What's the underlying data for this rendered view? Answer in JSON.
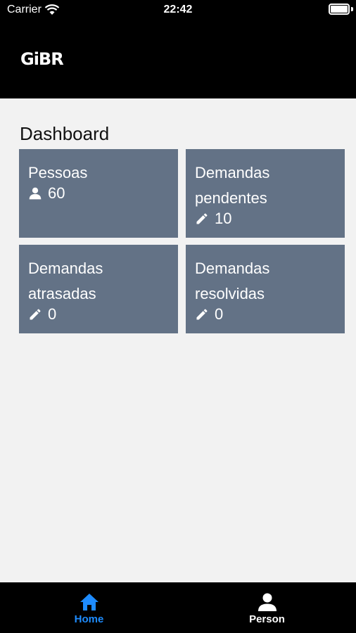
{
  "status_bar": {
    "carrier": "Carrier",
    "time": "22:42"
  },
  "header": {
    "logo": "GiBR"
  },
  "page": {
    "title": "Dashboard"
  },
  "cards": [
    {
      "title": "Pessoas",
      "value": "60",
      "icon": "person-icon"
    },
    {
      "title": "Demandas pendentes",
      "value": "10",
      "icon": "pencil-icon"
    },
    {
      "title": "Demandas atrasadas",
      "value": "0",
      "icon": "pencil-icon"
    },
    {
      "title": "Demandas resolvidas",
      "value": "0",
      "icon": "pencil-icon"
    }
  ],
  "tab_bar": {
    "home_label": "Home",
    "person_label": "Person",
    "active_color": "#1e8cff"
  },
  "colors": {
    "card": "#637286",
    "background": "#f2f2f2",
    "header": "#000000"
  }
}
